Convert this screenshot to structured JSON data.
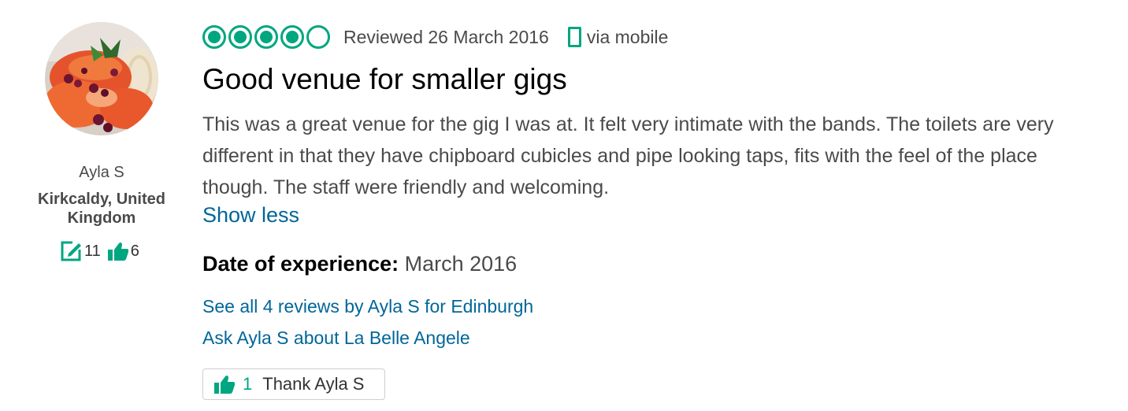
{
  "member": {
    "name": "Ayla S",
    "location": "Kirkcaldy, United Kingdom",
    "reviews_count": "11",
    "helpful_votes": "6",
    "avatar_icon": "avatar-photo",
    "reviews_icon": "pencil-square-icon",
    "votes_icon": "thumbs-up-icon"
  },
  "review": {
    "rating": 4,
    "rating_max": 5,
    "date_text": "Reviewed 26 March 2016",
    "via_text": "via mobile",
    "title": "Good venue for smaller gigs",
    "body": "This was a great venue for the gig I was at. It felt very intimate with the bands. The toilets are very different in that they have chipboard cubicles and pipe looking taps, fits with the feel of the place though. The staff were friendly and welcoming.",
    "show_less": "Show less",
    "experience_label": "Date of experience:",
    "experience_value": "March 2016"
  },
  "links": {
    "all_reviews": "See all 4 reviews by Ayla S for Edinburgh",
    "ask": "Ask Ayla S about La Belle Angele"
  },
  "thank": {
    "count": "1",
    "label": "Thank Ayla S"
  },
  "colors": {
    "accent_green": "#00a680",
    "link_blue": "#006699",
    "text_gray": "#4a4a4a"
  }
}
